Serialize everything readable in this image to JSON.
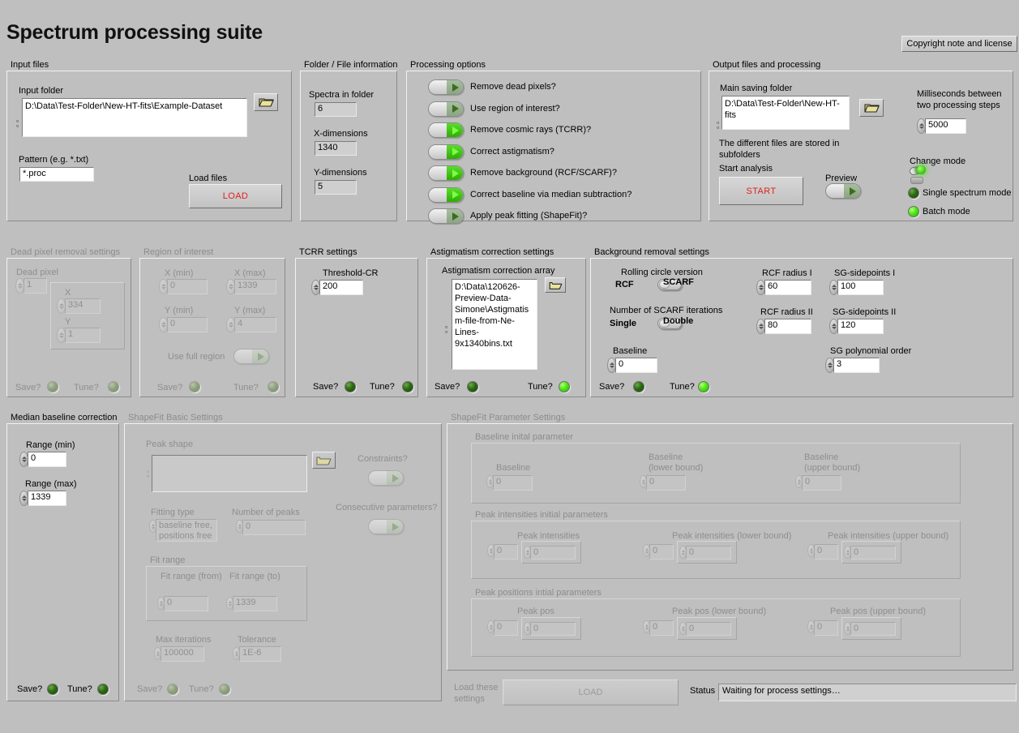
{
  "app": {
    "title": "Spectrum processing suite"
  },
  "copyright_button": {
    "label": "Copyright note and license"
  },
  "input_files": {
    "group_label": "Input files",
    "input_folder_label": "Input folder",
    "input_folder_value": "D:\\Data\\Test-Folder\\New-HT-fits\\Example-Dataset",
    "pattern_label": "Pattern (e.g. *.txt)",
    "pattern_value": "*.proc",
    "load_files_label": "Load files",
    "load_button": "LOAD",
    "browse_icon": "folder-icon"
  },
  "folder_info": {
    "group_label": "Folder / File information",
    "spectra_label": "Spectra in folder",
    "spectra_value": "6",
    "xdim_label": "X-dimensions",
    "xdim_value": "1340",
    "ydim_label": "Y-dimensions",
    "ydim_value": "5"
  },
  "processing_options": {
    "group_label": "Processing options",
    "items": [
      {
        "label": "Remove dead pixels?",
        "state": "off"
      },
      {
        "label": "Use region of interest?",
        "state": "off"
      },
      {
        "label": "Remove cosmic rays (TCRR)?",
        "state": "on"
      },
      {
        "label": "Correct astigmatism?",
        "state": "on"
      },
      {
        "label": "Remove background (RCF/SCARF)?",
        "state": "on"
      },
      {
        "label": "Correct baseline via median subtraction?",
        "state": "on"
      },
      {
        "label": "Apply peak fitting (ShapeFit)?",
        "state": "off"
      }
    ]
  },
  "output": {
    "group_label": "Output files and processing",
    "main_folder_label": "Main saving folder",
    "main_folder_value": "D:\\Data\\Test-Folder\\New-HT-fits",
    "note": "The different files are stored in subfolders",
    "start_analysis_label": "Start analysis",
    "start_button": "START",
    "preview_label": "Preview",
    "preview_state": "off",
    "ms_label_line1": "Milliseconds between",
    "ms_label_line2": "two processing steps",
    "ms_value": "5000",
    "change_mode_label": "Change mode",
    "single_mode_label": "Single spectrum mode",
    "single_mode_state": "off",
    "batch_mode_label": "Batch mode",
    "batch_mode_state": "on"
  },
  "dead_pixel": {
    "group_label": "Dead pixel removal settings",
    "enabled": false,
    "dead_pixel_label": "Dead pixel",
    "dead_pixel_value": "1",
    "x_label": "X",
    "x_value": "334",
    "y_label": "Y",
    "y_value": "1",
    "save_label": "Save?",
    "tune_label": "Tune?",
    "save_state": "dis",
    "tune_state": "dis"
  },
  "roi": {
    "group_label": "Region of interest",
    "enabled": false,
    "xmin_label": "X (min)",
    "xmin_value": "0",
    "xmax_label": "X (max)",
    "xmax_value": "1339",
    "ymin_label": "Y (min)",
    "ymin_value": "0",
    "ymax_label": "Y (max)",
    "ymax_value": "4",
    "full_region_label": "Use full region",
    "full_region_state": "dis",
    "save_label": "Save?",
    "tune_label": "Tune?",
    "save_state": "dis",
    "tune_state": "dis"
  },
  "tcrr": {
    "group_label": "TCRR settings",
    "threshold_label": "Threshold-CR",
    "threshold_value": "200",
    "save_label": "Save?",
    "tune_label": "Tune?",
    "save_state": "off",
    "tune_state": "off"
  },
  "astigmatism": {
    "group_label": "Astigmatism correction settings",
    "array_label": "Astigmatism correction array",
    "array_value": "D:\\Data\\120626-Preview-Data-Simone\\Astigmatism-file-from-Ne-Lines-9x1340bins.txt",
    "browse_icon": "folder-icon",
    "save_label": "Save?",
    "tune_label": "Tune?",
    "save_state": "off",
    "tune_state": "on"
  },
  "background": {
    "group_label": "Background removal settings",
    "rolling_circle_label": "Rolling circle version",
    "rcf_label": "RCF",
    "scarf_label": "SCARF",
    "rolling_circle_position": "left",
    "iterations_label": "Number of SCARF iterations",
    "single_label": "Single",
    "double_label": "Double",
    "iterations_position": "left",
    "baseline_label": "Baseline",
    "baseline_value": "0",
    "rcf_radius_1_label": "RCF radius I",
    "rcf_radius_1_value": "60",
    "rcf_radius_2_label": "RCF radius II",
    "rcf_radius_2_value": "80",
    "sg_sidepoints_1_label": "SG-sidepoints I",
    "sg_sidepoints_1_value": "100",
    "sg_sidepoints_2_label": "SG-sidepoints II",
    "sg_sidepoints_2_value": "120",
    "sg_poly_label": "SG polynomial order",
    "sg_poly_value": "3",
    "save_label": "Save?",
    "tune_label": "Tune?",
    "save_state": "off",
    "tune_state": "on"
  },
  "median_baseline": {
    "group_label": "Median baseline correction",
    "range_min_label": "Range (min)",
    "range_min_value": "0",
    "range_max_label": "Range (max)",
    "range_max_value": "1339",
    "save_label": "Save?",
    "tune_label": "Tune?",
    "save_state": "off",
    "tune_state": "off"
  },
  "shapefit_basic": {
    "group_label": "ShapeFit Basic Settings",
    "enabled": false,
    "peak_shape_label": "Peak shape",
    "peak_shape_value": "",
    "browse_icon": "folder-icon",
    "fitting_type_label": "Fitting type",
    "fitting_type_value": "baseline free, positions free",
    "num_peaks_label": "Number of peaks",
    "num_peaks_value": "0",
    "fit_range_label": "Fit range",
    "fit_from_label": "Fit range (from)",
    "fit_from_value": "0",
    "fit_to_label": "Fit range (to)",
    "fit_to_value": "1339",
    "max_iter_label": "Max iterations",
    "max_iter_value": "100000",
    "tolerance_label": "Tolerance",
    "tolerance_value": "1E-6",
    "constraints_label": "Constraints?",
    "constraints_state": "dis",
    "consecutive_label": "Consecutive parameters?",
    "consecutive_state": "dis",
    "save_label": "Save?",
    "tune_label": "Tune?",
    "save_state": "dis",
    "tune_state": "dis"
  },
  "shapefit_params": {
    "group_label": "ShapeFit Parameter Settings",
    "enabled": false,
    "baseline_section": "Baseline inital parameter",
    "baseline_label": "Baseline",
    "baseline_value": "0",
    "baseline_lower_label_1": "Baseline",
    "baseline_lower_label_2": "(lower bound)",
    "baseline_lower_value": "0",
    "baseline_upper_label_1": "Baseline",
    "baseline_upper_label_2": "(upper bound)",
    "baseline_upper_value": "0",
    "intensities_section": "Peak intensities initial parameters",
    "pi_label": "Peak intensities",
    "pi_value": "0",
    "pi_value2": "0",
    "pi_low_label": "Peak intensities (lower bound)",
    "pi_low_value": "0",
    "pi_low_value2": "0",
    "pi_up_label": "Peak intensities (upper bound)",
    "pi_up_value": "0",
    "pi_up_value2": "0",
    "positions_section": "Peak positions intial parameters",
    "pp_label": "Peak pos",
    "pp_value": "0",
    "pp_value2": "0",
    "pp_low_label": "Peak pos (lower bound)",
    "pp_low_value": "0",
    "pp_low_value2": "0",
    "pp_up_label": "Peak pos (upper bound)",
    "pp_up_value": "0",
    "pp_up_value2": "0"
  },
  "footer": {
    "load_settings_label_1": "Load these",
    "load_settings_label_2": "settings",
    "load_button": "LOAD",
    "status_label": "Status",
    "status_value": "Waiting for process settings…"
  },
  "colors": {
    "background": "#bfbfbf",
    "led_on": "#4de812",
    "led_off": "#2b6b10",
    "accent_red": "#e02020"
  }
}
